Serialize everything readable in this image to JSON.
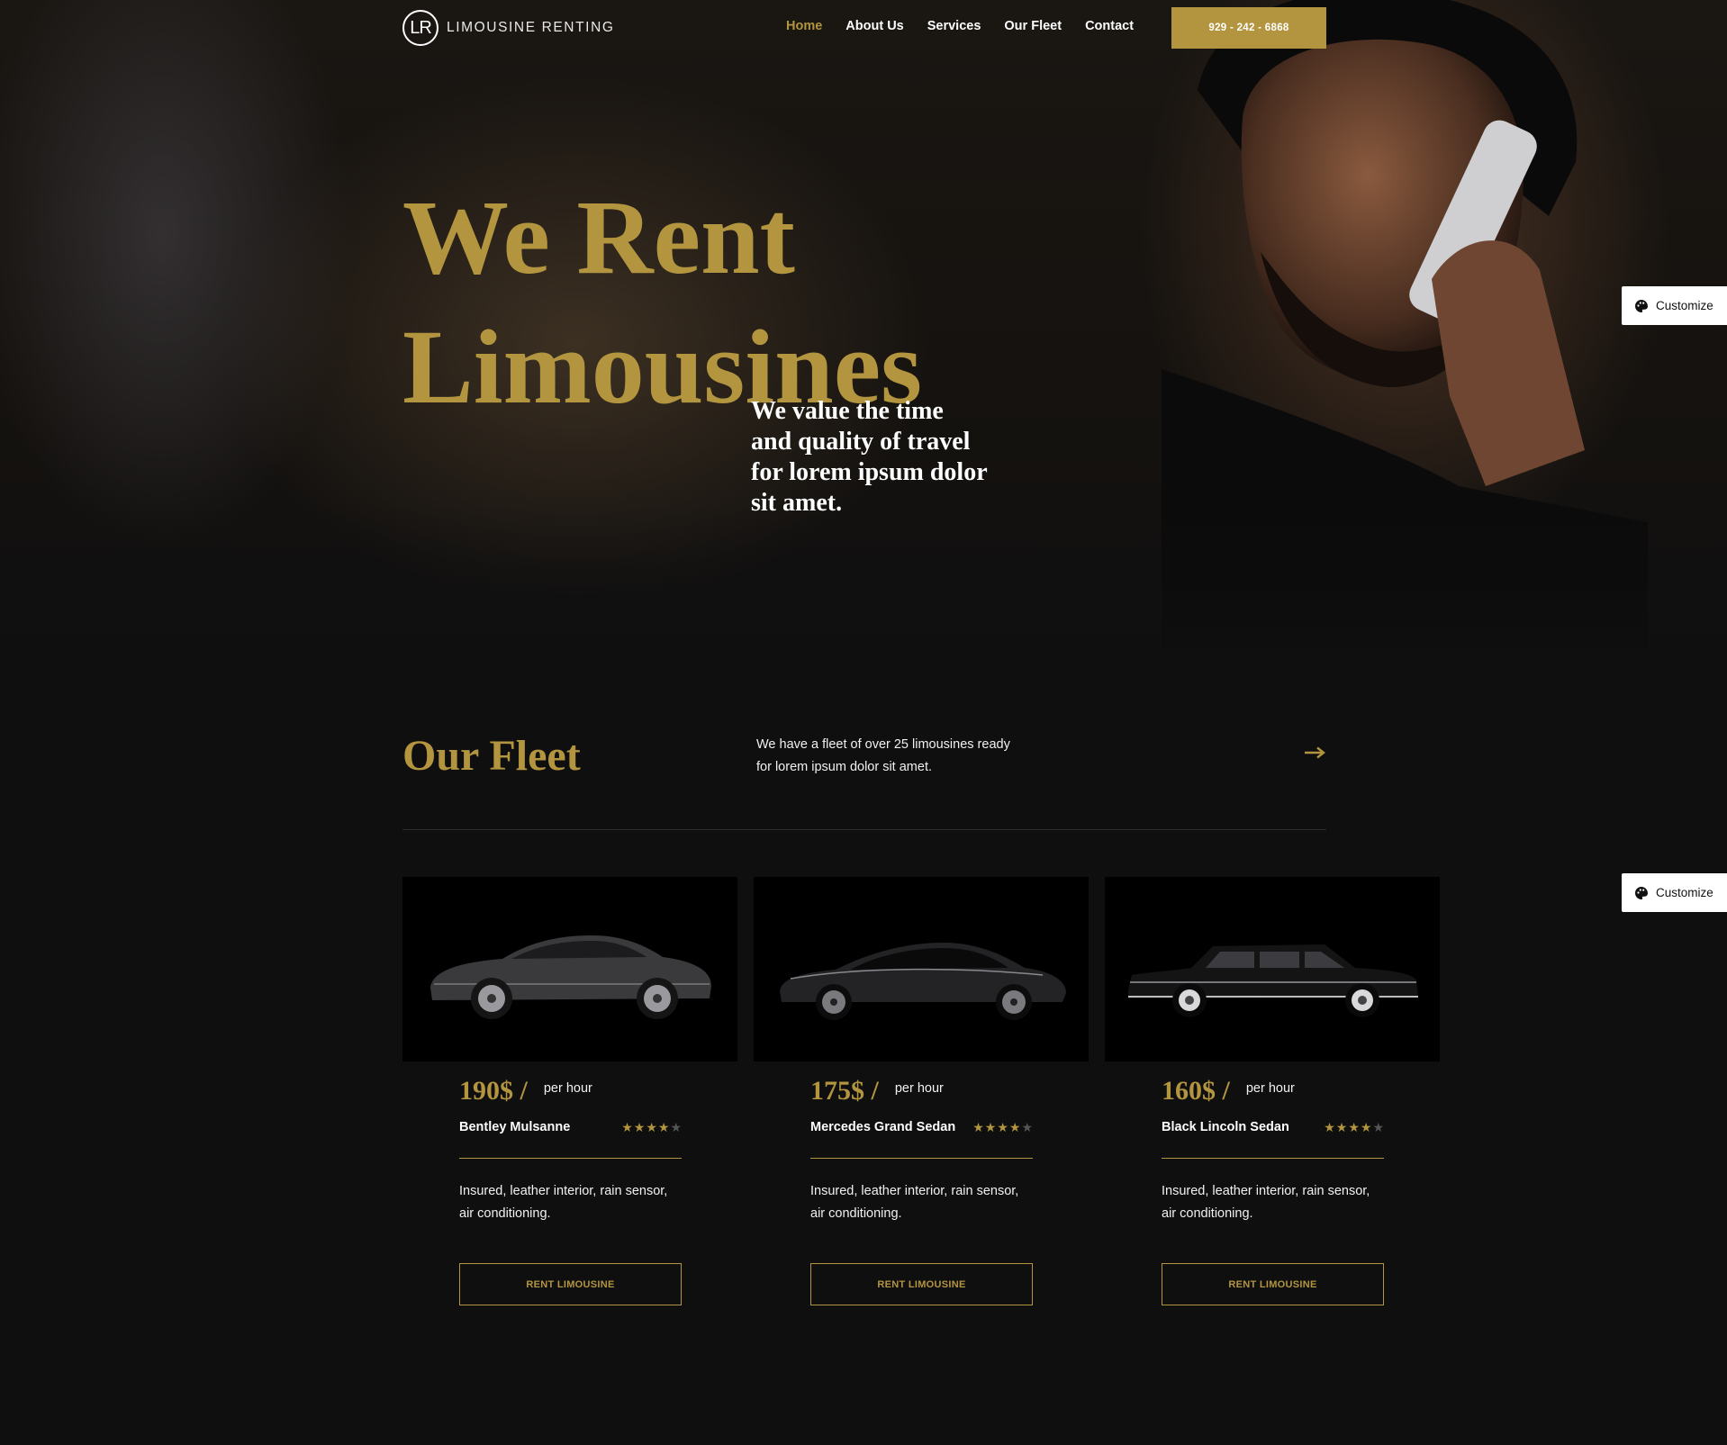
{
  "brand": {
    "mark": "LR",
    "name": "LIMOUSINE RENTING"
  },
  "nav": {
    "items": [
      {
        "label": "Home",
        "active": true
      },
      {
        "label": "About Us",
        "active": false
      },
      {
        "label": "Services",
        "active": false
      },
      {
        "label": "Our Fleet",
        "active": false
      },
      {
        "label": "Contact",
        "active": false
      }
    ],
    "phone": "929 - 242 - 6868"
  },
  "hero": {
    "title_line1": "We Rent",
    "title_line2": "Limousines",
    "subtitle": "We value the time and quality of travel for lorem ipsum dolor sit amet."
  },
  "customize": {
    "label": "Customize"
  },
  "fleet": {
    "title": "Our Fleet",
    "description": "We have a fleet of over 25 limousines ready for lorem ipsum dolor sit amet.",
    "cars": [
      {
        "price": "190$ /",
        "unit": "per hour",
        "name": "Bentley Mulsanne",
        "rating": 4,
        "rating_max": 5,
        "text": "Insured, leather interior, rain sensor, air conditioning.",
        "button": "RENT LIMOUSINE"
      },
      {
        "price": "175$ /",
        "unit": "per hour",
        "name": "Mercedes Grand Sedan",
        "rating": 4,
        "rating_max": 5,
        "text": "Insured, leather interior, rain sensor, air conditioning.",
        "button": "RENT LIMOUSINE"
      },
      {
        "price": "160$ /",
        "unit": "per hour",
        "name": "Black Lincoln Sedan",
        "rating": 4,
        "rating_max": 5,
        "text": "Insured, leather interior, rain sensor, air conditioning.",
        "button": "RENT LIMOUSINE"
      }
    ]
  },
  "colors": {
    "accent": "#b3953f",
    "background": "#0f0f10",
    "text": "#ffffff"
  },
  "icons": {
    "arrow": "arrow-right-icon",
    "palette": "palette-icon",
    "star": "star-icon"
  }
}
